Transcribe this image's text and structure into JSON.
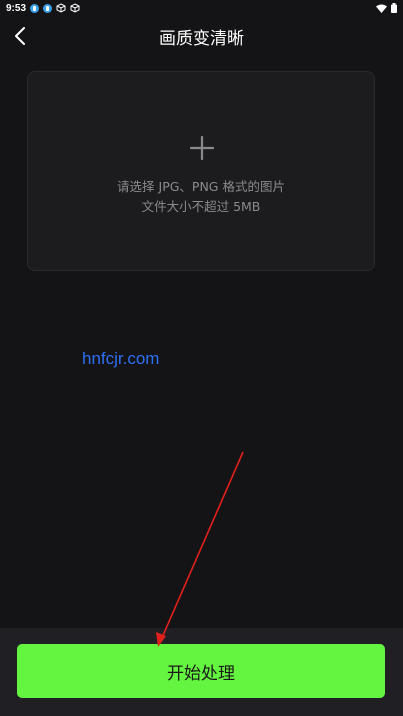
{
  "status_bar": {
    "time": "9:53"
  },
  "header": {
    "title": "画质变清晰",
    "back_icon": "chevron-left-icon"
  },
  "upload": {
    "icon": "plus-icon",
    "hint_line1": "请选择 JPG、PNG 格式的图片",
    "hint_line2": "文件大小不超过 5MB"
  },
  "watermark": {
    "text": "hnfcjr.com"
  },
  "bottom": {
    "start_label": "开始处理",
    "button_color": "#63f53f"
  },
  "annotation": {
    "arrow_color": "#e0201c"
  },
  "colors": {
    "background": "#141416",
    "card": "#1c1c1f",
    "hint_text": "#8a8a8e",
    "watermark": "#2e6ff0"
  }
}
